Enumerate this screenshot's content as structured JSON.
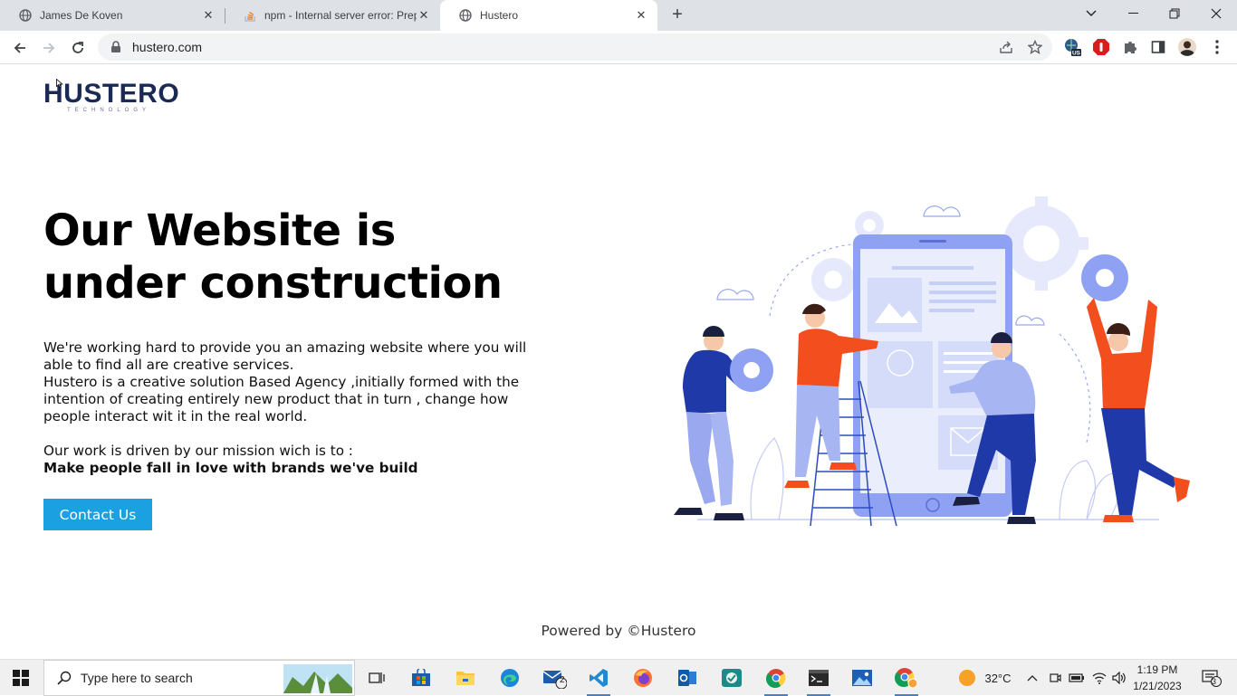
{
  "browser": {
    "tabs": [
      {
        "title": "James De Koven",
        "icon": "globe-icon"
      },
      {
        "title": "npm - Internal server error: Prepr",
        "icon": "stackoverflow-icon"
      },
      {
        "title": "Hustero",
        "icon": "globe-icon"
      }
    ],
    "url": "hustero.com"
  },
  "page": {
    "logo": {
      "word": "HUSTERO",
      "sub": "TECHNOLOGY"
    },
    "heading": [
      "Our Website is",
      "under construction"
    ],
    "paragraphs": [
      "We're working hard to provide you an amazing website where you will able to find all are creative services.",
      "Hustero is a creative solution Based Agency ,initially formed with the intention of creating entirely new product that in turn , change how people interact wit it in the real world."
    ],
    "mission_intro": "Our work is driven by our mission wich is to :",
    "mission": "Make people fall in love with brands we've build",
    "contact_label": "Contact Us",
    "footer": "Powered by ©Hustero"
  },
  "taskbar": {
    "search_placeholder": "Type here to search",
    "mail_badge": "2",
    "weather": "32°C",
    "time": "1:19 PM",
    "date": "1/21/2023",
    "notifications": "3"
  },
  "colors": {
    "accent": "#1ba1e2",
    "illustration_blue": "#7b8ff0",
    "illustration_orange": "#f24e1e",
    "illustration_navy": "#1f3aa8"
  }
}
